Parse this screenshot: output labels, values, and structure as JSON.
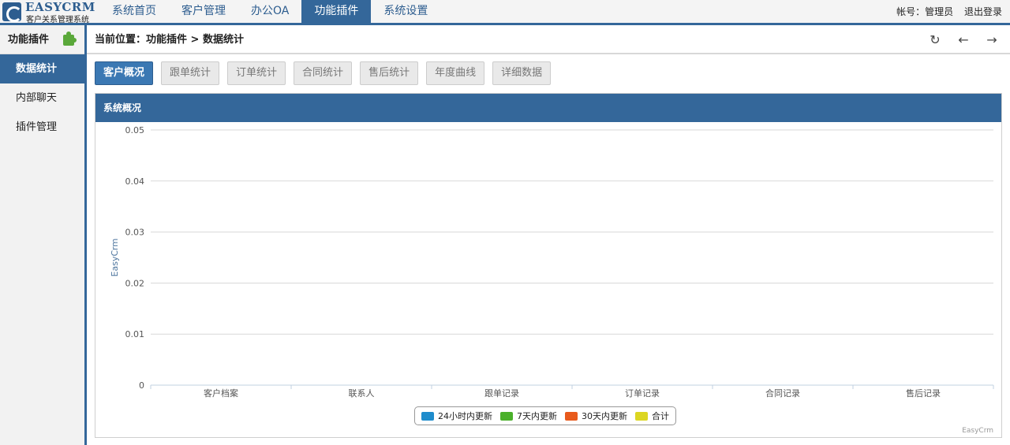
{
  "app": {
    "logo_title": "EASYCRM",
    "logo_subtitle": "客户关系管理系统"
  },
  "nav": {
    "items": [
      "系统首页",
      "客户管理",
      "办公OA",
      "功能插件",
      "系统设置"
    ],
    "active": "功能插件"
  },
  "user": {
    "account": "帐号：管理员",
    "logout": "退出登录"
  },
  "sidebar": {
    "title": "功能插件",
    "items": [
      "数据统计",
      "内部聊天",
      "插件管理"
    ],
    "active": "数据统计"
  },
  "breadcrumb": {
    "text": "当前位置：功能插件 > 数据统计"
  },
  "tabs": {
    "items": [
      "客户概况",
      "跟单统计",
      "订单统计",
      "合同统计",
      "售后统计",
      "年度曲线",
      "详细数据"
    ],
    "active": "客户概况"
  },
  "panel": {
    "title": "系统概况"
  },
  "chart_data": {
    "type": "bar",
    "title": "",
    "ylabel": "EasyCrm",
    "xlabel": "",
    "categories": [
      "客户档案",
      "联系人",
      "跟单记录",
      "订单记录",
      "合同记录",
      "售后记录"
    ],
    "y_ticks": [
      "0",
      "0.01",
      "0.02",
      "0.03",
      "0.04",
      "0.05"
    ],
    "ylim": [
      0,
      0.05
    ],
    "grid": true,
    "legend_position": "bottom-center",
    "series": [
      {
        "name": "24小时内更新",
        "color": "#1e8ccc",
        "values": [
          0,
          0,
          0,
          0,
          0,
          0
        ]
      },
      {
        "name": "7天内更新",
        "color": "#4ab02a",
        "values": [
          0,
          0,
          0,
          0,
          0,
          0
        ]
      },
      {
        "name": "30天内更新",
        "color": "#e85a1c",
        "values": [
          0,
          0,
          0,
          0,
          0,
          0
        ]
      },
      {
        "name": "合计",
        "color": "#dcd622",
        "values": [
          0,
          0,
          0,
          0,
          0,
          0
        ]
      }
    ],
    "credit": "EasyCrm"
  }
}
